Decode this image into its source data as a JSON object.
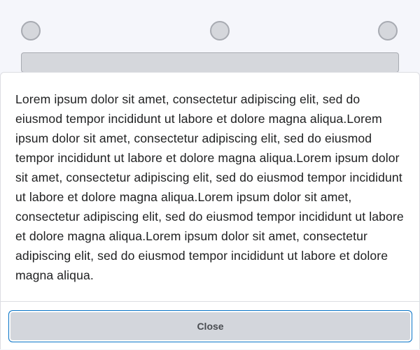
{
  "dialog": {
    "body_text": "Lorem ipsum dolor sit amet, consectetur adipiscing elit, sed do eiusmod tempor incididunt ut labore et dolore magna aliqua.Lorem ipsum dolor sit amet, consectetur adipiscing elit, sed do eiusmod tempor incididunt ut labore et dolore magna aliqua.Lorem ipsum dolor sit amet, consectetur adipiscing elit, sed do eiusmod tempor incididunt ut labore et dolore magna aliqua.Lorem ipsum dolor sit amet, consectetur adipiscing elit, sed do eiusmod tempor incididunt ut labore et dolore magna aliqua.Lorem ipsum dolor sit amet, consectetur adipiscing elit, sed do eiusmod tempor incididunt ut labore et dolore magna aliqua.",
    "close_label": "Close"
  },
  "colors": {
    "page_background": "#f5f6fb",
    "placeholder_fill": "#d5d7dc",
    "placeholder_border": "#a8abb2",
    "sheet_background": "#ffffff",
    "text": "#202122",
    "button_fill": "#d3d6dc",
    "button_text": "#494c51",
    "focus_ring": "#0874c7"
  }
}
